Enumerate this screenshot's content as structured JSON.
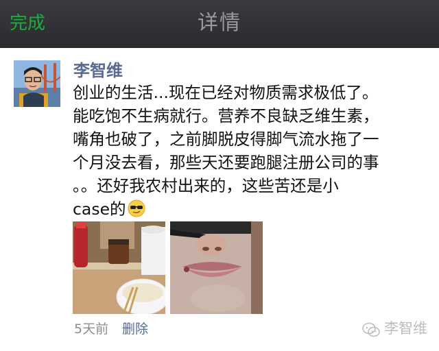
{
  "navbar": {
    "done_label": "完成",
    "title": "详情"
  },
  "post": {
    "author": "李智维",
    "text_lines": [
      "创业的生活...现在已经对物质需求极低了。",
      "能吃饱不生病就行。营养不良缺乏维生素，",
      "嘴角也破了，之前脚脱皮得脚气流水拖了一",
      "个月没去看，那些天还要跑腿注册公司的事",
      "。。还好我农村出来的，这些苦还是小",
      "case的"
    ],
    "emoji_icon": "cool-sunglasses-emoji",
    "time": "5天前",
    "delete_label": "删除",
    "images": [
      {
        "name": "food-photo"
      },
      {
        "name": "lip-photo"
      }
    ]
  },
  "watermark": {
    "icon": "wechat-icon",
    "text": "李智维"
  },
  "colors": {
    "navbar_bg": "#2f2f33",
    "done": "#1aad3e",
    "author": "#586b95",
    "timestamp": "#8e8e8e"
  }
}
